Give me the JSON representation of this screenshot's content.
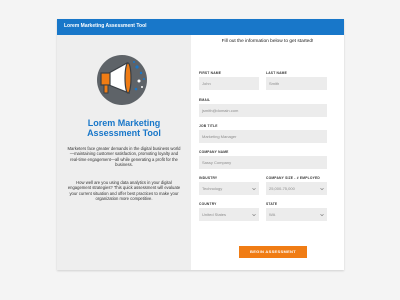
{
  "header": {
    "title": "Lorem Marketing Assessment Tool"
  },
  "left": {
    "title": "Lorem Marketing\nAssessment Tool",
    "paragraph1": "Marketers face greater demands in the digital business world—maintaining customer satisfaction, promoting loyalty and real-time engagement—all while generating a profit for the business.",
    "paragraph2": "How well are you using data analytics in your digital engagement strategies? This quick assessment will evaluate your current situation and offer best practices to make your organization more competitive.",
    "illustration_icon": "megaphone-icon"
  },
  "form": {
    "intro": "Fill out the information below to get started!",
    "first_name": {
      "label": "FIRST NAME",
      "placeholder": "John"
    },
    "last_name": {
      "label": "LAST NAME",
      "placeholder": "Smith"
    },
    "email": {
      "label": "EMAIL",
      "placeholder": "jsmith@domain.com"
    },
    "job_title": {
      "label": "JOB TITLE",
      "placeholder": "Marketing Manager"
    },
    "company_name": {
      "label": "COMPANY NAME",
      "placeholder": "Sassy Company"
    },
    "industry": {
      "label": "INDUSTRY",
      "value": "Technology"
    },
    "company_size": {
      "label": "COMPANY SIZE - # EMPLOYED",
      "value": "25,000-75,000"
    },
    "country": {
      "label": "COUNTRY",
      "value": "United States"
    },
    "state": {
      "label": "STATE",
      "value": "WA"
    },
    "submit_label": "BEGIN ASSESSMENT"
  },
  "colors": {
    "header": "#1877c9",
    "accent": "#f07c14",
    "title": "#1877c9"
  }
}
